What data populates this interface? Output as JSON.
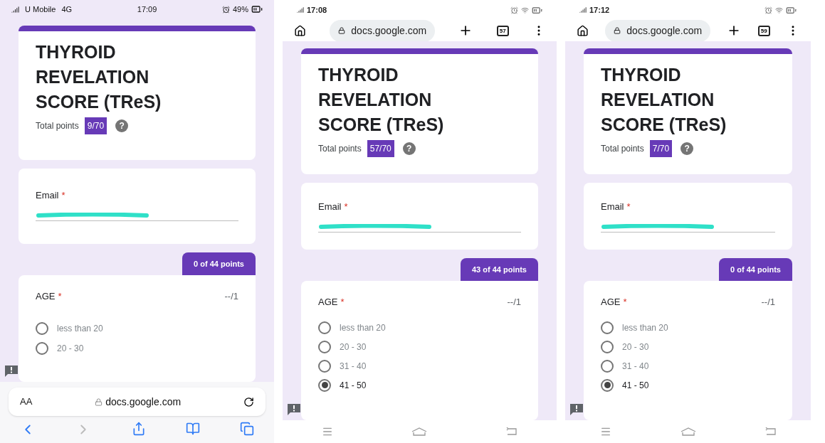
{
  "phones": [
    {
      "kind": "ios",
      "status_bar": {
        "carrier": "U Mobile",
        "network": "4G",
        "time": "17:09",
        "battery": "49%"
      },
      "browser": {
        "text_size": "AA",
        "url": "docs.google.com"
      },
      "form": {
        "title": "THYROID REVELATION SCORE (TReS)",
        "total_label": "Total points",
        "total_score": "9/70",
        "help": "?",
        "email_label": "Email",
        "required_mark": "*",
        "section_points": "0 of 44 points",
        "question": {
          "label": "AGE",
          "required_mark": "*",
          "points": "--/1",
          "options": [
            {
              "label": "less than 20",
              "selected": false
            },
            {
              "label": "20 - 30",
              "selected": false
            }
          ]
        }
      }
    },
    {
      "kind": "android",
      "status_bar": {
        "time": "17:08"
      },
      "browser": {
        "url": "docs.google.com",
        "tab_count": "57"
      },
      "form": {
        "title": "THYROID REVELATION SCORE (TReS)",
        "total_label": "Total points",
        "total_score": "57/70",
        "help": "?",
        "email_label": "Email",
        "required_mark": "*",
        "section_points": "43 of 44 points",
        "question": {
          "label": "AGE",
          "required_mark": "*",
          "points": "--/1",
          "options": [
            {
              "label": "less than 20",
              "selected": false
            },
            {
              "label": "20 - 30",
              "selected": false
            },
            {
              "label": "31 - 40",
              "selected": false
            },
            {
              "label": "41 - 50",
              "selected": true
            }
          ]
        }
      }
    },
    {
      "kind": "android",
      "status_bar": {
        "time": "17:12"
      },
      "browser": {
        "url": "docs.google.com",
        "tab_count": "59"
      },
      "form": {
        "title": "THYROID REVELATION SCORE (TReS)",
        "total_label": "Total points",
        "total_score": "7/70",
        "help": "?",
        "email_label": "Email",
        "required_mark": "*",
        "section_points": "0 of 44 points",
        "question": {
          "label": "AGE",
          "required_mark": "*",
          "points": "--/1",
          "options": [
            {
              "label": "less than 20",
              "selected": false
            },
            {
              "label": "20 - 30",
              "selected": false
            },
            {
              "label": "31 - 40",
              "selected": false
            },
            {
              "label": "41 - 50",
              "selected": true
            }
          ]
        }
      }
    }
  ]
}
